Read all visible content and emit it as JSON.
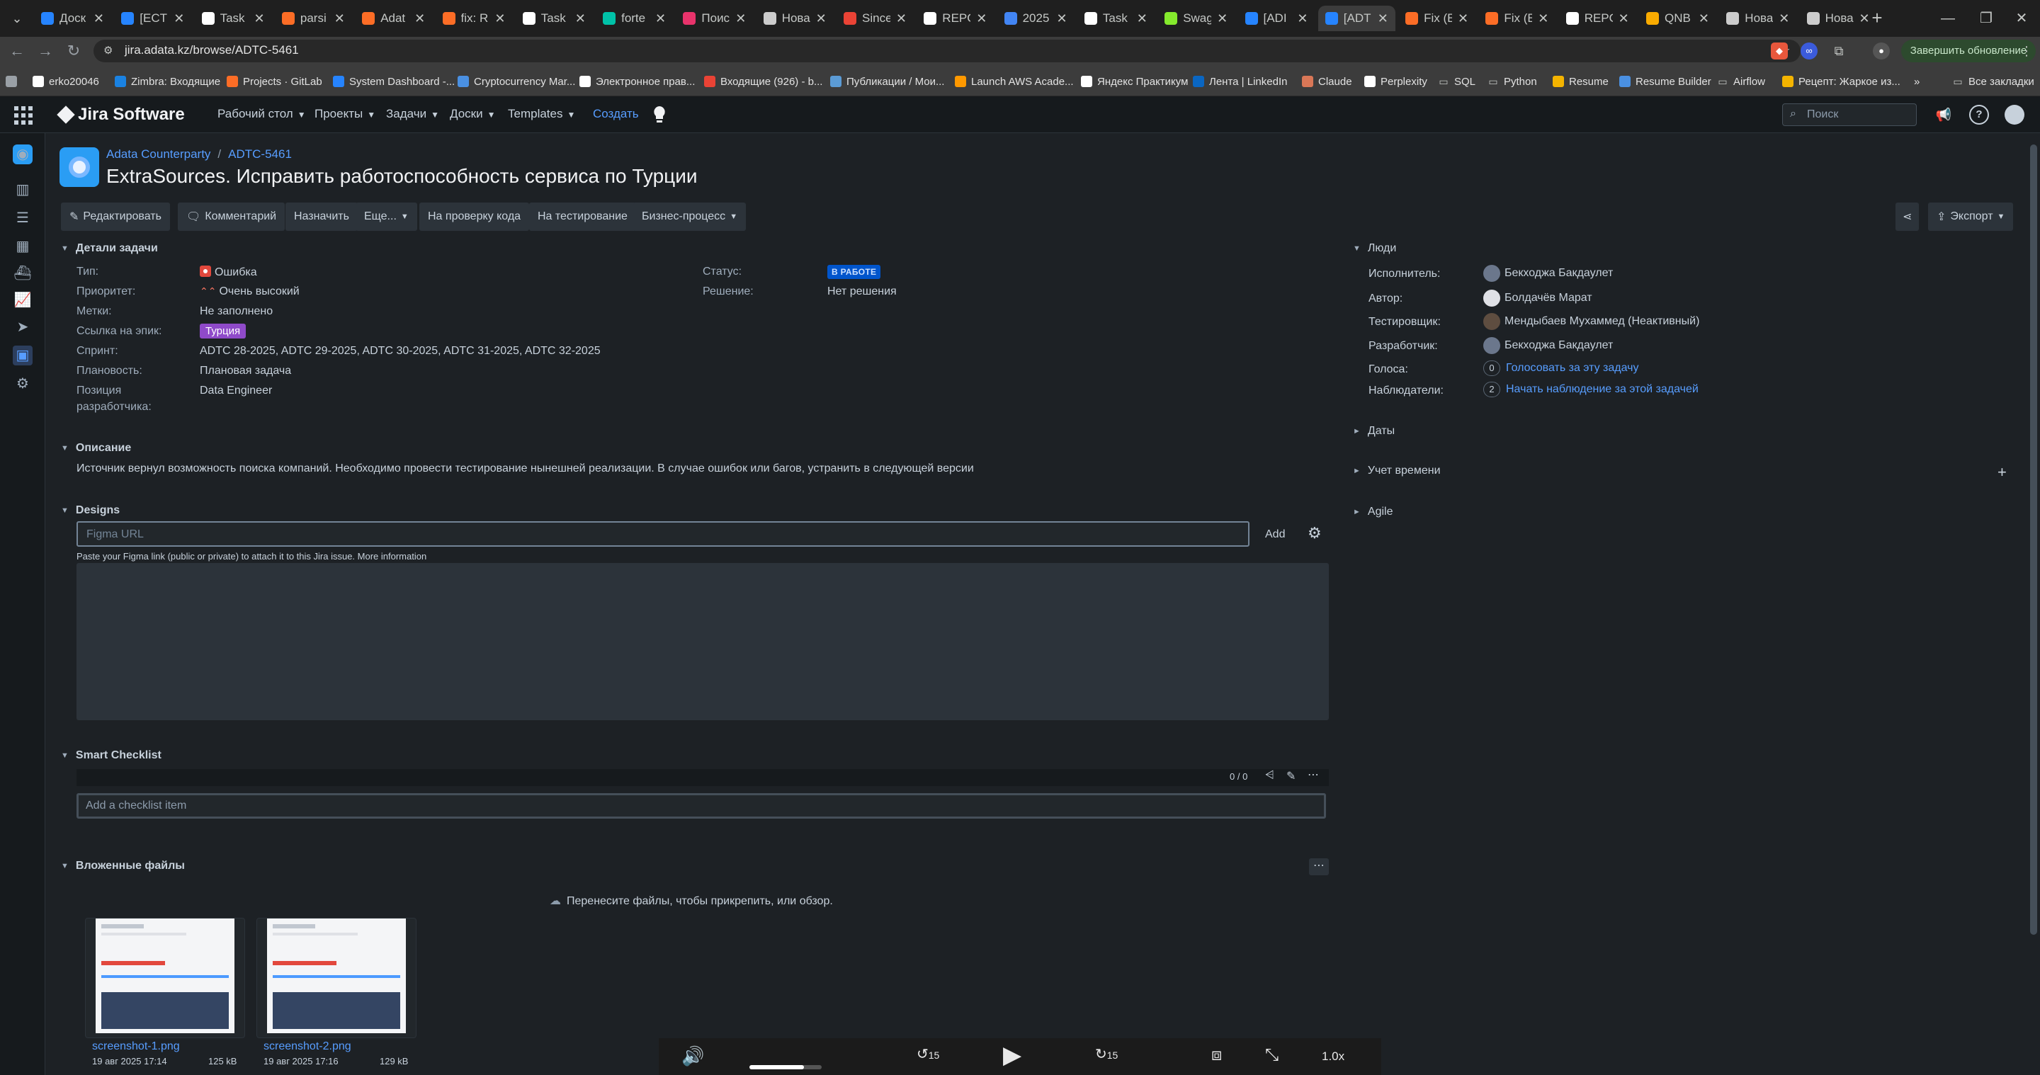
{
  "browser": {
    "tabs": [
      {
        "title": "Доск",
        "icon": "jira",
        "color": "#2684ff"
      },
      {
        "title": "[ECT",
        "icon": "jira",
        "color": "#2684ff"
      },
      {
        "title": "Task",
        "icon": "notion",
        "color": "#ffffff"
      },
      {
        "title": "parsi",
        "icon": "gitlab",
        "color": "#fc6d26"
      },
      {
        "title": "Adat",
        "icon": "gitlab",
        "color": "#fc6d26"
      },
      {
        "title": "fix: R",
        "icon": "gitlab",
        "color": "#fc6d26"
      },
      {
        "title": "Task",
        "icon": "notion",
        "color": "#ffffff"
      },
      {
        "title": "forte",
        "icon": "forte",
        "color": "#00c2a8"
      },
      {
        "title": "Поис",
        "icon": "search",
        "color": "#e8336b"
      },
      {
        "title": "Нова",
        "icon": "chatgpt",
        "color": "#cccccc"
      },
      {
        "title": "Since",
        "icon": "since",
        "color": "#ea4335"
      },
      {
        "title": "REPO",
        "icon": "notion",
        "color": "#ffffff"
      },
      {
        "title": "2025",
        "icon": "docs",
        "color": "#4285f4"
      },
      {
        "title": "Task",
        "icon": "notion",
        "color": "#ffffff"
      },
      {
        "title": "Swag",
        "icon": "swagger",
        "color": "#85ea2d"
      },
      {
        "title": "[ADI",
        "icon": "jira",
        "color": "#2684ff"
      },
      {
        "title": "[ADT",
        "icon": "jira",
        "color": "#2684ff"
      },
      {
        "title": "Fix (E",
        "icon": "gitlab",
        "color": "#fc6d26"
      },
      {
        "title": "Fix (E",
        "icon": "gitlab",
        "color": "#fc6d26"
      },
      {
        "title": "REPO",
        "icon": "notion",
        "color": "#ffffff"
      },
      {
        "title": "QNB",
        "icon": "chart",
        "color": "#f9ab00"
      },
      {
        "title": "Нова",
        "icon": "chatgpt",
        "color": "#cccccc"
      },
      {
        "title": "Нова",
        "icon": "chatgpt",
        "color": "#cccccc"
      }
    ],
    "active_tab_index": 16,
    "url": "jira.adata.kz/browse/ADTC-5461",
    "update_button": "Завершить обновление",
    "bookmarks": [
      {
        "label": "",
        "icon": "apps",
        "color": "#9aa0a6"
      },
      {
        "label": "erko20046",
        "icon": "github",
        "color": "#ffffff"
      },
      {
        "label": "Zimbra: Входящие",
        "icon": "zimbra",
        "color": "#1a82e2"
      },
      {
        "label": "Projects · GitLab",
        "icon": "gitlab",
        "color": "#fc6d26"
      },
      {
        "label": "System Dashboard -...",
        "icon": "jira",
        "color": "#2684ff"
      },
      {
        "label": "Cryptocurrency Mar...",
        "icon": "crypto",
        "color": "#4a90e2"
      },
      {
        "label": "Электронное прав...",
        "icon": "egov",
        "color": "#ffffff"
      },
      {
        "label": "Входящие (926) - b...",
        "icon": "gmail",
        "color": "#ea4335"
      },
      {
        "label": "Публикации / Мои...",
        "icon": "pub",
        "color": "#5b9bd5"
      },
      {
        "label": "Launch AWS Acade...",
        "icon": "aws",
        "color": "#ff9900"
      },
      {
        "label": "Яндекс Практикум",
        "icon": "yandex",
        "color": "#ffffff"
      },
      {
        "label": "Лента | LinkedIn",
        "icon": "linkedin",
        "color": "#0a66c2"
      },
      {
        "label": "Claude",
        "icon": "claude",
        "color": "#d97757"
      },
      {
        "label": "Perplexity",
        "icon": "perplexity",
        "color": "#ffffff"
      },
      {
        "label": "SQL",
        "icon": "folder",
        "color": "#c4c7c5"
      },
      {
        "label": "Python",
        "icon": "folder",
        "color": "#c4c7c5"
      },
      {
        "label": "Resume",
        "icon": "resume",
        "color": "#f4b400"
      },
      {
        "label": "Resume Builder",
        "icon": "rb",
        "color": "#4a90e2"
      },
      {
        "label": "Airflow",
        "icon": "folder",
        "color": "#c4c7c5"
      },
      {
        "label": "Рецепт: Жаркое из...",
        "icon": "recipe",
        "color": "#f4b400"
      }
    ],
    "bookmarks_more": "»",
    "all_bookmarks": "Все закладки"
  },
  "jira": {
    "product": "Jira Software",
    "nav": [
      {
        "label": "Рабочий стол"
      },
      {
        "label": "Проекты"
      },
      {
        "label": "Задачи"
      },
      {
        "label": "Доски"
      },
      {
        "label": "Templates"
      }
    ],
    "create": "Создать",
    "search_placeholder": "Поиск"
  },
  "issue": {
    "project": "Adata Counterparty",
    "key": "ADTC-5461",
    "title": "ExtraSources. Исправить работоспособность сервиса по Турции",
    "actions": {
      "edit": "Редактировать",
      "comment": "Комментарий",
      "assign": "Назначить",
      "more": "Еще...",
      "code_review": "На проверку кода",
      "testing": "На тестирование",
      "workflow": "Бизнес-процесс",
      "export": "Экспорт"
    },
    "details": {
      "title": "Детали задачи",
      "type_label": "Тип:",
      "type": "Ошибка",
      "priority_label": "Приоритет:",
      "priority": "Очень высокий",
      "labels_label": "Метки:",
      "labels": "Не заполнено",
      "epic_label": "Ссылка на эпик:",
      "epic": "Турция",
      "sprint_label": "Спринт:",
      "sprint": "ADTC 28-2025, ADTC 29-2025, ADTC 30-2025, ADTC 31-2025, ADTC 32-2025",
      "planning_label": "Плановость:",
      "planning": "Плановая задача",
      "position_label_1": "Позиция",
      "position_label_2": "разработчика:",
      "position": "Data Engineer",
      "status_label": "Статус:",
      "status": "В РАБОТЕ",
      "resolution_label": "Решение:",
      "resolution": "Нет решения"
    },
    "description": {
      "title": "Описание",
      "text": "Источник вернул возможность поиска компаний. Необходимо провести тестирование нынешней реализации. В случае ошибок или багов, устранить в следующей версии"
    },
    "designs": {
      "title": "Designs",
      "placeholder": "Figma URL",
      "add": "Add",
      "hint": "Paste your Figma link (public or private) to attach it to this Jira issue. More information"
    },
    "checklist": {
      "title": "Smart Checklist",
      "count": "0 / 0",
      "placeholder": "Add a checklist item"
    },
    "attachments": {
      "title": "Вложенные файлы",
      "drop": "Перенесите файлы, чтобы прикрепить, или обзор.",
      "files": [
        {
          "name": "screenshot-1.png",
          "date": "19 авг 2025 17:14",
          "size": "125 kB"
        },
        {
          "name": "screenshot-2.png",
          "date": "19 авг 2025 17:16",
          "size": "129 kB"
        }
      ]
    },
    "people": {
      "title": "Люди",
      "assignee_label": "Исполнитель:",
      "assignee": "Бекходжа Бакдаулет",
      "reporter_label": "Автор:",
      "reporter": "Болдачёв Марат",
      "tester_label": "Тестировщик:",
      "tester": "Мендыбаев Мухаммед (Неактивный)",
      "developer_label": "Разработчик:",
      "developer": "Бекходжа Бакдаулет",
      "votes_label": "Голоса:",
      "votes": "0",
      "vote_link": "Голосовать за эту задачу",
      "watchers_label": "Наблюдатели:",
      "watchers": "2",
      "watch_link": "Начать наблюдение за этой задачей"
    },
    "side_sections": {
      "dates": "Даты",
      "time": "Учет времени",
      "agile": "Agile"
    }
  },
  "media": {
    "skip_back": "15",
    "skip_fwd": "15",
    "speed": "1.0x",
    "volume_level": 0.75
  }
}
